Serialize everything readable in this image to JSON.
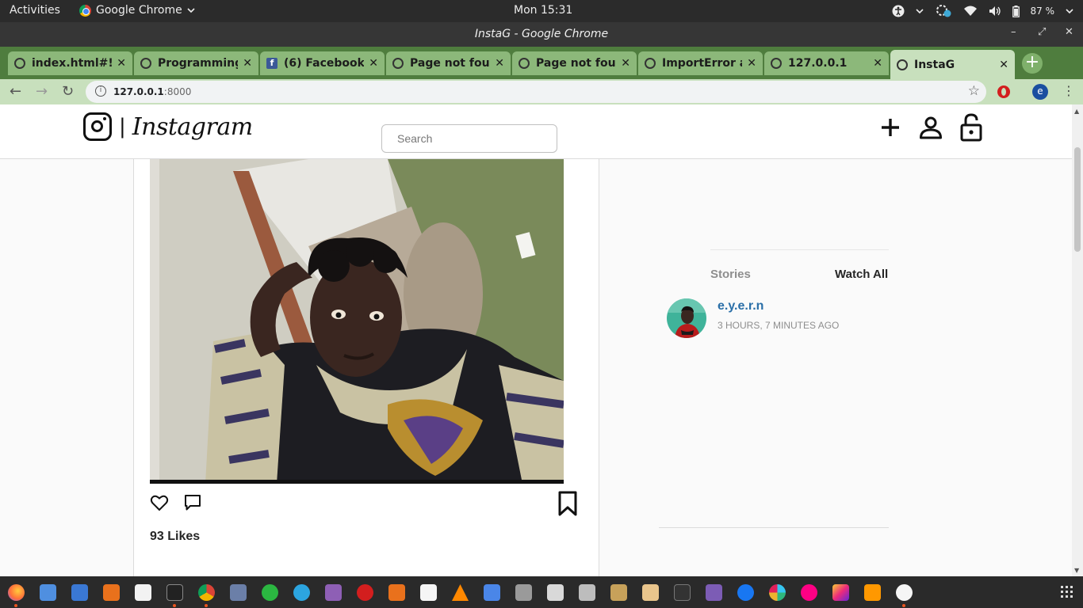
{
  "topbar": {
    "activities": "Activities",
    "app_name": "Google Chrome",
    "clock": "Mon 15:31",
    "battery": "87 %"
  },
  "window": {
    "title": "InstaG - Google Chrome"
  },
  "tabs": [
    {
      "label": "index.html#!/c",
      "icon": "globe-icon"
    },
    {
      "label": "Programming",
      "icon": "globe-icon"
    },
    {
      "label": "(6) Facebook",
      "icon": "facebook-icon"
    },
    {
      "label": "Page not four",
      "icon": "globe-icon"
    },
    {
      "label": "Page not four",
      "icon": "globe-icon"
    },
    {
      "label": "ImportError a",
      "icon": "globe-icon"
    },
    {
      "label": "127.0.0.1",
      "icon": "globe-icon"
    },
    {
      "label": "InstaG",
      "icon": "globe-icon",
      "active": true
    }
  ],
  "address_bar": {
    "host": "127.0.0.1",
    "port": ":8000"
  },
  "instagram": {
    "brand": "Instagram",
    "separator": "|",
    "search_placeholder": "Search",
    "post": {
      "likes": "93 Likes"
    },
    "stories": {
      "title": "Stories",
      "watch_all": "Watch All",
      "items": [
        {
          "user": "e.y.e.r.n",
          "time": "3 HOURS, 7 MINUTES AGO"
        }
      ]
    }
  },
  "dock": {
    "apps": [
      "firefox",
      "files-doc",
      "writer",
      "app-store",
      "amazon",
      "terminal",
      "chrome",
      "bluetooth-tool",
      "whatsapp",
      "telegram",
      "notes",
      "opera",
      "calculator",
      "cards",
      "vlc",
      "tasks",
      "screenshot",
      "scanner",
      "tools",
      "file-manager",
      "archive",
      "system-monitor",
      "media",
      "messenger",
      "slack",
      "flickr",
      "instagram",
      "sublime",
      "glasses"
    ]
  },
  "colors": {
    "tab_strip": "#4f7d3e",
    "active_tab": "#c8e0bd",
    "story_user_link": "#2a6fa8"
  }
}
